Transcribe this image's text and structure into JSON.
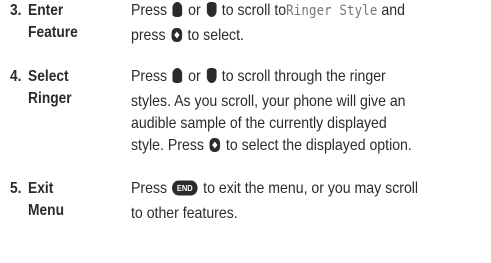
{
  "steps": [
    {
      "number": "3.",
      "title_line1": "Enter",
      "title_line2": "Feature",
      "body": {
        "part1": "Press",
        "or": "or",
        "part2": "to scroll to",
        "lcd_text": "Ringer Style",
        "part3": "and",
        "line2_part1": "press",
        "line2_part2": "to select."
      }
    },
    {
      "number": "4.",
      "title_line1": "Select",
      "title_line2": "Ringer",
      "body": {
        "part1": "Press",
        "or": "or",
        "part2": "to scroll through the ringer",
        "line2": "styles. As you scroll, your phone will give an",
        "line3": "audible sample of the currently displayed",
        "line4_part1": "style. Press",
        "line4_part2": "to select the displayed option."
      }
    },
    {
      "number": "5.",
      "title_line1": "Exit",
      "title_line2": "Menu",
      "body": {
        "part1": "Press",
        "key_label": "END",
        "part2": "to exit the menu, or you may scroll",
        "line2": "to other features."
      }
    }
  ],
  "icons": {
    "up": "scroll-up-key-icon",
    "down": "scroll-down-key-icon",
    "select": "select-key-icon",
    "end": "end-key-icon"
  }
}
